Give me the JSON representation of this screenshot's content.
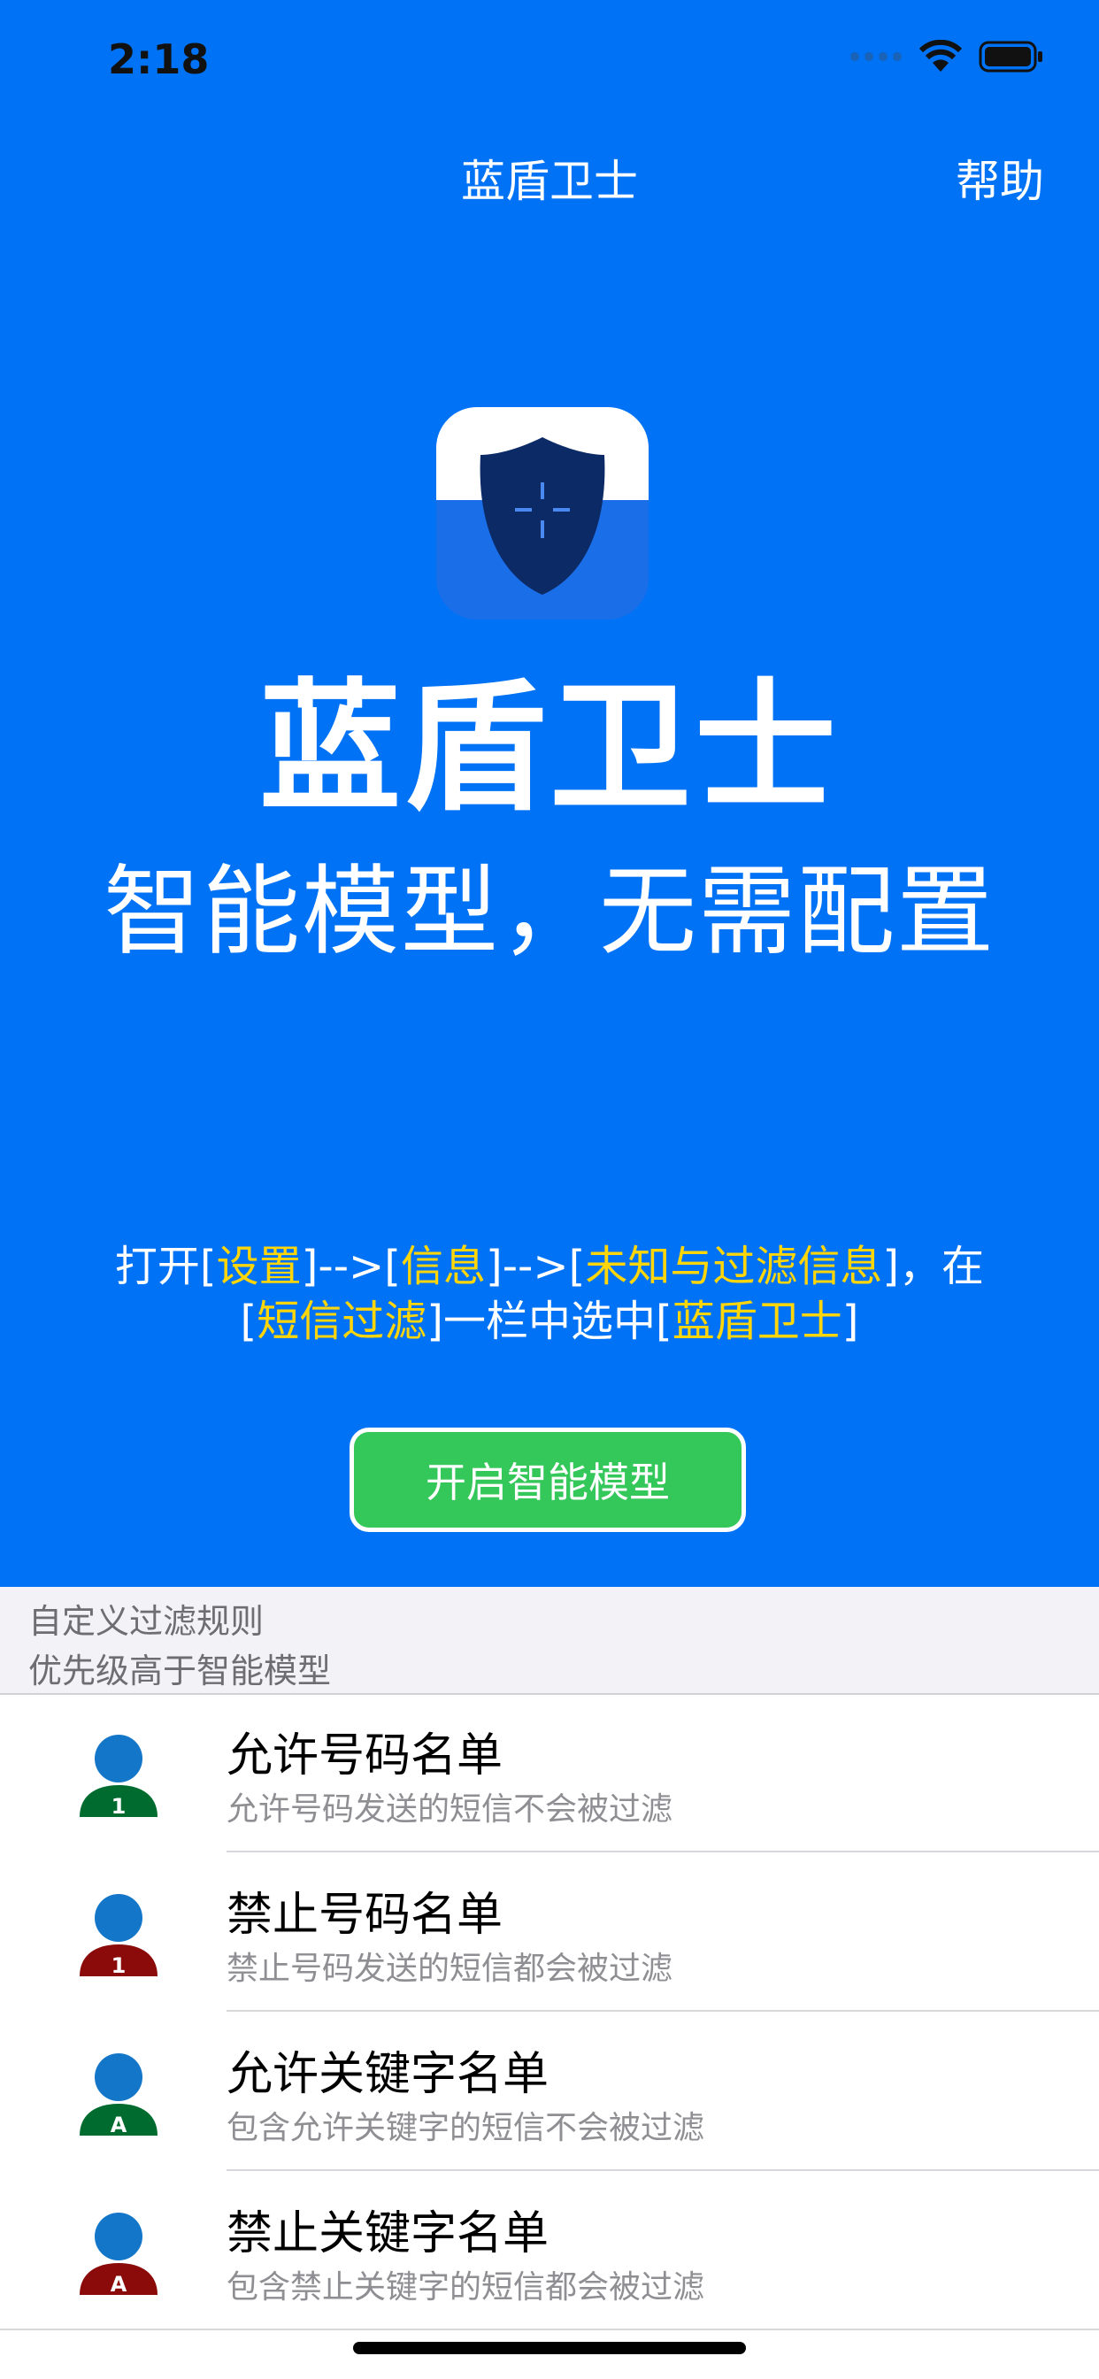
{
  "status_bar": {
    "time": "2:18"
  },
  "nav": {
    "title": "蓝盾卫士",
    "help": "帮助"
  },
  "hero": {
    "title": "蓝盾卫士",
    "subtitle": "智能模型，无需配置"
  },
  "instructions": {
    "line1": [
      {
        "text": "打开[",
        "hl": false
      },
      {
        "text": "设置",
        "hl": true
      },
      {
        "text": "]-->[",
        "hl": false
      },
      {
        "text": "信息",
        "hl": true
      },
      {
        "text": "]-->[",
        "hl": false
      },
      {
        "text": "未知与过滤信息",
        "hl": true
      },
      {
        "text": "]，在",
        "hl": false
      }
    ],
    "line2": [
      {
        "text": "[",
        "hl": false
      },
      {
        "text": "短信过滤",
        "hl": true
      },
      {
        "text": "]一栏中选中[",
        "hl": false
      },
      {
        "text": "蓝盾卫士",
        "hl": true
      },
      {
        "text": "]",
        "hl": false
      }
    ]
  },
  "enable_button": "开启智能模型",
  "section": {
    "line1": "自定义过滤规则",
    "line2": "优先级高于智能模型"
  },
  "list": [
    {
      "title": "允许号码名单",
      "desc": "允许号码发送的短信不会被过滤",
      "badge": "1",
      "shirt_color": "#006b2e",
      "icon": "allow-number-icon"
    },
    {
      "title": "禁止号码名单",
      "desc": "禁止号码发送的短信都会被过滤",
      "badge": "1",
      "shirt_color": "#8b0a0a",
      "icon": "block-number-icon"
    },
    {
      "title": "允许关键字名单",
      "desc": "包含允许关键字的短信不会被过滤",
      "badge": "A",
      "shirt_color": "#006b2e",
      "icon": "allow-keyword-icon"
    },
    {
      "title": "禁止关键字名单",
      "desc": "包含禁止关键字的短信都会被过滤",
      "badge": "A",
      "shirt_color": "#8b0a0a",
      "icon": "block-keyword-icon"
    }
  ],
  "colors": {
    "background": "#0072f5",
    "highlight": "#ffd60a",
    "button": "#34c759"
  }
}
